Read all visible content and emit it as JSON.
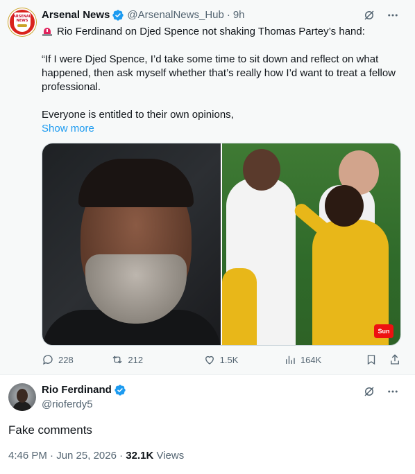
{
  "quoted_tweet": {
    "author_name": "Arsenal News",
    "handle": "@ArsenalNews_Hub",
    "separator": "·",
    "time": "9h",
    "avatar_text": [
      "ARSENAL",
      "NEWS"
    ],
    "lines": [
      "Rio Ferdinand on Djed Spence not shaking Thomas Partey’s hand:",
      "“If I were Djed Spence, I’d take some time to sit down and reflect on what happened, then ask myself whether that’s really how I’d want to treat a fellow professional.",
      "Everyone is entitled to their own opinions,"
    ],
    "show_more": "Show more",
    "media_logo": "Sun",
    "metrics": {
      "replies": "228",
      "retweets": "212",
      "likes": "1.5K",
      "views": "164K"
    }
  },
  "reply_tweet": {
    "author_name": "Rio Ferdinand",
    "handle": "@rioferdy5",
    "text": "Fake comments",
    "time": "4:46 PM · Jun 25, 2026 ·",
    "views_count": "32.1K",
    "views_label": "Views"
  },
  "colors": {
    "accent": "#1d9bf0",
    "muted": "#536471",
    "text": "#0f1419",
    "quoted_bg": "#f7f9f9"
  },
  "icons": [
    "verified-badge-icon",
    "grok-icon",
    "more-icon",
    "reply-icon",
    "retweet-icon",
    "like-icon",
    "views-icon",
    "bookmark-icon",
    "share-icon",
    "siren-icon"
  ]
}
